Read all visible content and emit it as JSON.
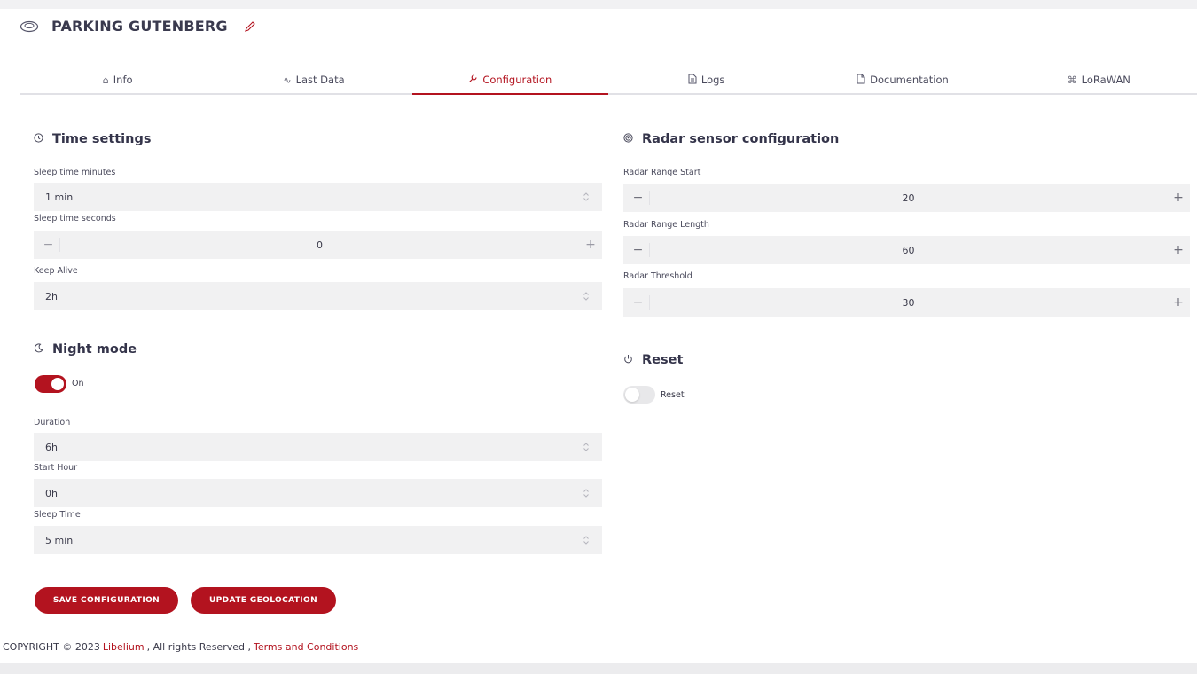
{
  "header": {
    "title": "PARKING GUTENBERG",
    "device_icon": "parking-sensor-icon",
    "edit_icon": "pencil-icon"
  },
  "tabs": [
    {
      "label": "Info",
      "icon": "home-icon",
      "glyph": "⌂",
      "active": false
    },
    {
      "label": "Last Data",
      "icon": "activity-icon",
      "glyph": "∿",
      "active": false
    },
    {
      "label": "Configuration",
      "icon": "wrench-icon",
      "glyph": "🔧",
      "active": true
    },
    {
      "label": "Logs",
      "icon": "document-icon",
      "glyph": "🗎",
      "active": false
    },
    {
      "label": "Documentation",
      "icon": "file-icon",
      "glyph": "🗋",
      "active": false
    },
    {
      "label": "LoRaWAN",
      "icon": "command-icon",
      "glyph": "⌘",
      "active": false
    }
  ],
  "time_settings": {
    "title": "Time settings",
    "icon": "clock-icon",
    "sleep_minutes": {
      "label": "Sleep time minutes",
      "value": "1 min"
    },
    "sleep_seconds": {
      "label": "Sleep time seconds",
      "value": "0"
    },
    "keep_alive": {
      "label": "Keep Alive",
      "value": "2h"
    }
  },
  "night_mode": {
    "title": "Night mode",
    "icon": "moon-icon",
    "toggle_label": "On",
    "enabled": true,
    "duration": {
      "label": "Duration",
      "value": "6h"
    },
    "start_hour": {
      "label": "Start Hour",
      "value": "0h"
    },
    "sleep_time": {
      "label": "Sleep Time",
      "value": "5 min"
    }
  },
  "radar": {
    "title": "Radar sensor configuration",
    "icon": "radar-icon",
    "range_start": {
      "label": "Radar Range Start",
      "value": "20"
    },
    "range_length": {
      "label": "Radar Range Length",
      "value": "60"
    },
    "threshold": {
      "label": "Radar Threshold",
      "value": "30"
    }
  },
  "reset": {
    "title": "Reset",
    "icon": "power-icon",
    "toggle_label": "Reset",
    "enabled": false
  },
  "buttons": {
    "save": "SAVE CONFIGURATION",
    "geolocation": "UPDATE GEOLOCATION"
  },
  "footer": {
    "copyright": "COPYRIGHT © 2023",
    "brand": "Libelium",
    "rights": ", All rights Reserved ,",
    "terms": "Terms and Conditions"
  },
  "colors": {
    "accent": "#b3131f",
    "field_bg": "#f1f1f2",
    "text": "#3a3a4e"
  }
}
